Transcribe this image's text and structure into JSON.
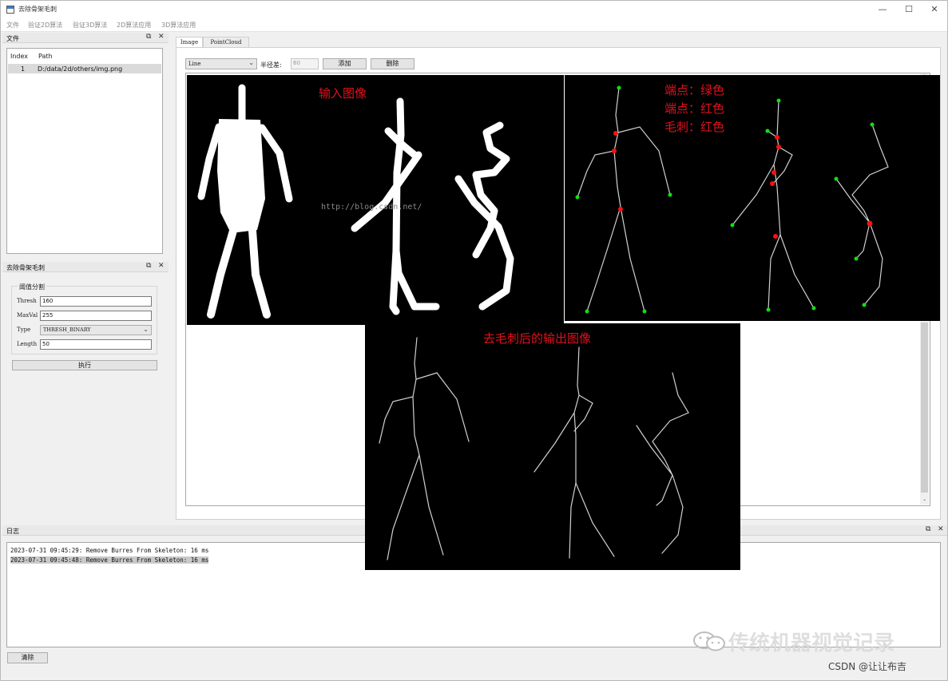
{
  "window": {
    "title": "去除骨架毛刺",
    "minimize": "—",
    "maximize": "☐",
    "close": "✕"
  },
  "menu": [
    "文件",
    "验证2D算法",
    "验证3D算法",
    "2D算法应用",
    "3D算法应用"
  ],
  "file_dock": {
    "title": "文件",
    "columns": [
      "Index",
      "Path"
    ],
    "rows": [
      {
        "index": "1",
        "path": "D:/data/2d/others/img.png"
      }
    ]
  },
  "burr_dock": {
    "title": "去除骨架毛刺",
    "group_title": "阈值分割",
    "thresh_label": "Thresh",
    "thresh_value": "160",
    "maxval_label": "MaxVal",
    "maxval_value": "255",
    "type_label": "Type",
    "type_value": "THRESH_BINARY",
    "length_label": "Length",
    "length_value": "50",
    "run_button": "执行"
  },
  "tabs": [
    "Image",
    "PointCloud"
  ],
  "toolbar": {
    "shape_value": "Line",
    "radius_label": "半径差:",
    "radius_value": "60",
    "add_button": "添加",
    "delete_button": "删除"
  },
  "overlay": {
    "input_label": "输入图像",
    "legend": [
      "端点：绿色",
      "端点：红色",
      "毛刺：红色"
    ],
    "output_label": "去毛刺后的输出图像",
    "url_watermark": "http://blog.csdn.net/"
  },
  "log_dock": {
    "title": "日志",
    "lines": [
      "2023-07-31 09:45:29: Remove Burres From Skeleton: 16 ms",
      "2023-07-31 09:45:48: Remove Burres From Skeleton: 16 ms"
    ],
    "clear_button": "清除"
  },
  "watermarks": {
    "brand": "传统机器视觉记录",
    "csdn": "CSDN @让让布吉"
  },
  "icons": {
    "float": "float-icon",
    "close": "close-icon",
    "dropdown": "chevron-down-icon",
    "app": "app-icon",
    "wechat": "wechat-icon"
  },
  "colors": {
    "endpoint": "#00d000",
    "branch_point": "#e00000",
    "label_red": "#e0111c"
  }
}
